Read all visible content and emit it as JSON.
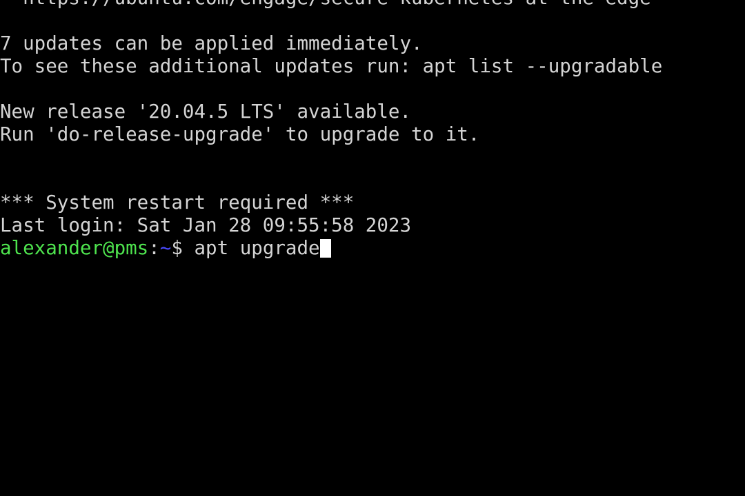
{
  "terminal": {
    "background_color": "#000000",
    "foreground_color": "#d4d4d4",
    "prompt_user_color": "#4ee44e",
    "prompt_path_color": "#4a4aff",
    "cursor_color": "#ffffff",
    "lines": [
      {
        "id": "motd-url",
        "text": "  https://ubuntu.com/engage/secure-kubernetes-at-the-edge"
      },
      {
        "id": "blank-1",
        "text": ""
      },
      {
        "id": "motd-updates-count",
        "text": "7 updates can be applied immediately."
      },
      {
        "id": "motd-updates-hint",
        "text": "To see these additional updates run: apt list --upgradable"
      },
      {
        "id": "blank-2",
        "text": ""
      },
      {
        "id": "motd-new-release",
        "text": "New release '20.04.5 LTS' available."
      },
      {
        "id": "motd-release-hint",
        "text": "Run 'do-release-upgrade' to upgrade to it."
      },
      {
        "id": "blank-3",
        "text": ""
      },
      {
        "id": "blank-4",
        "text": ""
      },
      {
        "id": "motd-restart",
        "text": "*** System restart required ***"
      },
      {
        "id": "last-login",
        "text": "Last login: Sat Jan 28 09:55:58 2023"
      }
    ],
    "prompt": {
      "user_host": "alexander@pms",
      "separator": ":",
      "path": "~",
      "sigil": "$",
      "space": " ",
      "command": " apt upgrade",
      "cursor_glyph": " "
    }
  }
}
